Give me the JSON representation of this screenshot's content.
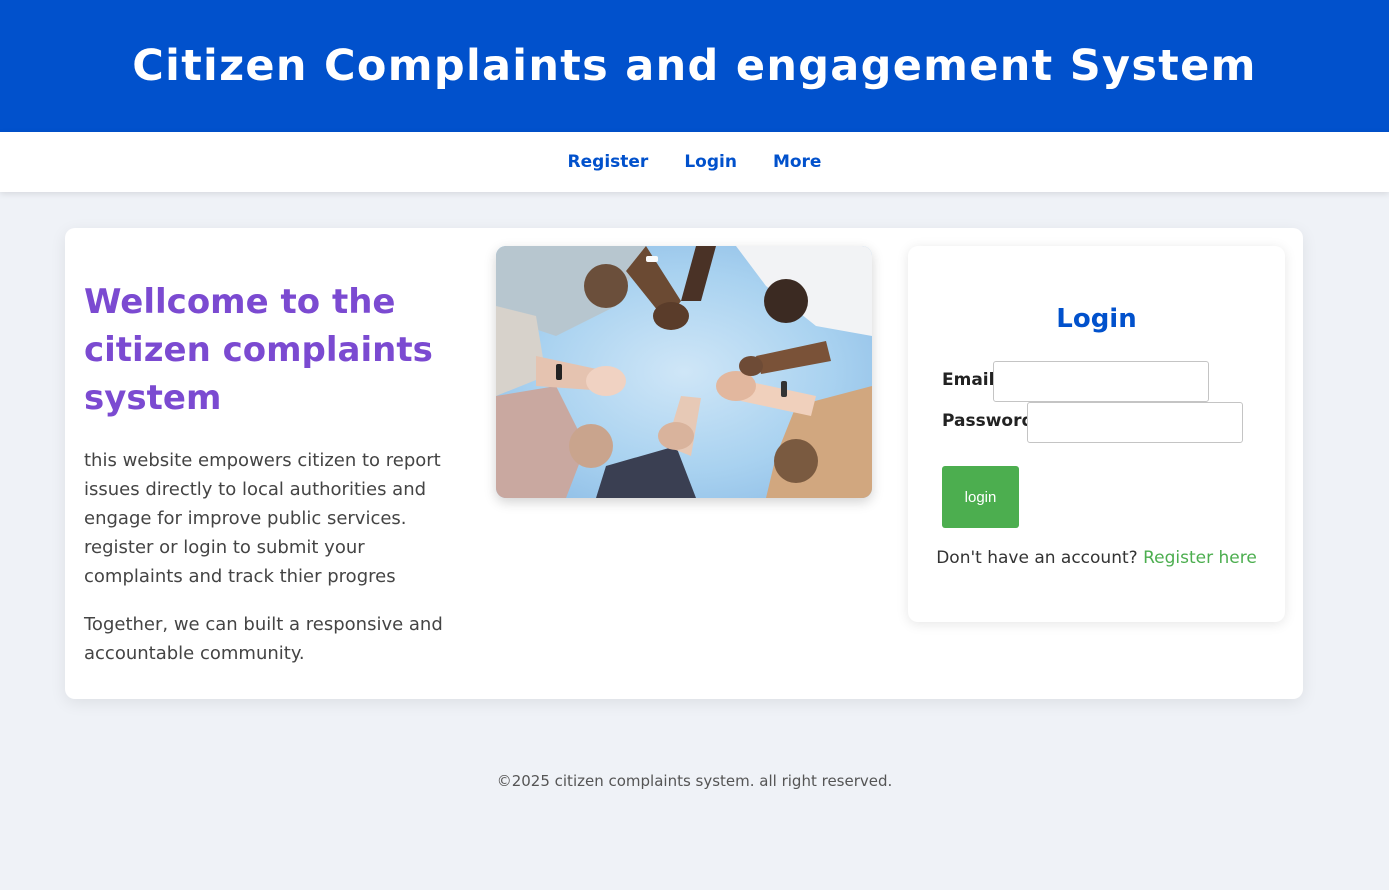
{
  "header": {
    "title": "Citizen Complaints and engagement System",
    "background": "#0151cc"
  },
  "nav": {
    "items": [
      {
        "label": "Register"
      },
      {
        "label": "Login"
      },
      {
        "label": "More"
      }
    ]
  },
  "welcome": {
    "heading": "Wellcome to the citizen complaints system",
    "paragraph1": "this website empowers citizen to report issues directly to local authorities and engage for improve public services. register or login to submit your complaints and track thier progres",
    "paragraph2": "Together, we can built a responsive and accountable community.",
    "heading_color": "#7b4ad1"
  },
  "hero_image": {
    "icon": "hands-circle-photo"
  },
  "login": {
    "heading": "Login",
    "email_label": "Email",
    "email_value": "",
    "password_label": "Password",
    "password_value": "",
    "button_label": "login",
    "button_color": "#4cae4f",
    "register_prompt": "Don't have an account?",
    "register_link": "Register here"
  },
  "footer": {
    "text": "©2025 citizen complaints system. all right reserved."
  }
}
